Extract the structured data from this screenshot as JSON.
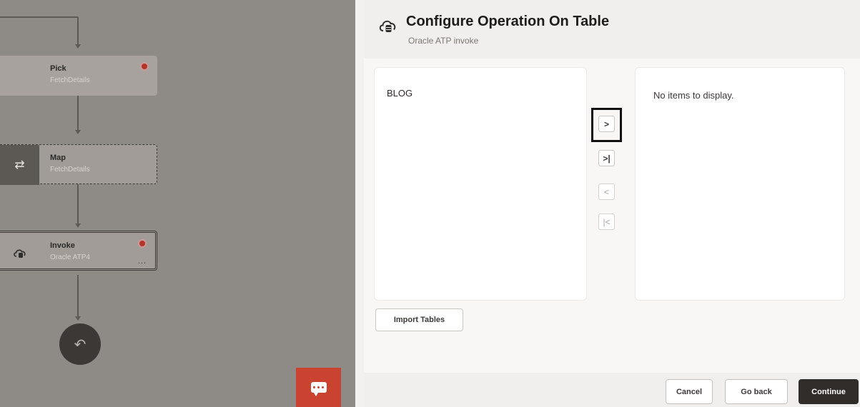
{
  "canvas": {
    "nodes": [
      {
        "title": "Pick",
        "subtitle": "FetchDetails",
        "has_error": true
      },
      {
        "title": "Map",
        "subtitle": "FetchDetails",
        "icon": "swap-arrows-icon"
      },
      {
        "title": "Invoke",
        "subtitle": "Oracle ATP4",
        "has_error": true,
        "more": "..."
      }
    ],
    "end_icon": "return-arrow-icon",
    "chat_icon": "chat-bubble-icon"
  },
  "dialog": {
    "title": "Configure Operation On Table",
    "subtitle": "Oracle ATP invoke",
    "icon": "database-cloud-icon",
    "available_tables": [
      "BLOG"
    ],
    "selected_empty_text": "No items to display.",
    "shuttle": {
      "move_selected": ">",
      "move_all": ">|",
      "remove_selected": "<",
      "remove_all": "|<"
    },
    "import_label": "Import Tables"
  },
  "footer": {
    "cancel": "Cancel",
    "go_back": "Go back",
    "continue": "Continue"
  },
  "colors": {
    "canvas_overlay": "#8e8a86",
    "accent_chat": "#c94330",
    "primary_button": "#312d2a",
    "error": "#b3342b"
  }
}
